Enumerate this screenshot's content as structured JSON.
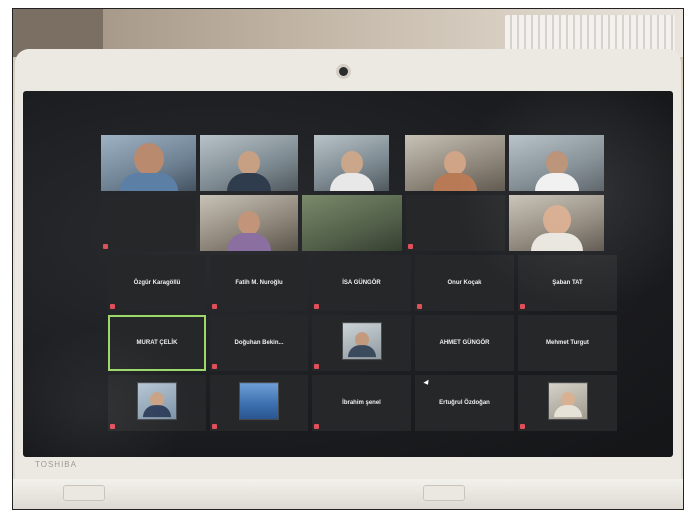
{
  "laptop": {
    "brand": "TOSHIBA"
  },
  "meeting": {
    "grid_names": [
      "Özgür Karagöllü",
      "Fatih M. Nuroğlu",
      "İSA GÜNGÖR",
      "Onur Koçak",
      "Şaban TAT",
      "MURAT ÇELİK",
      "Doğuhan Bekin...",
      "AHMET GÜNGÖR",
      "Mehmet Turgut",
      "İbrahim şenel",
      "Ertuğrul Özdoğan"
    ],
    "active_speaker": "MURAT ÇELİK",
    "colors": {
      "active_outline": "#9cd86a",
      "muted_mic": "#e0505a",
      "screen_bg": "#1c1d20"
    }
  }
}
